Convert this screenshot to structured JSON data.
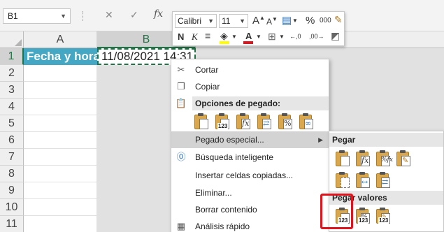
{
  "formula_bar": {
    "name_box": "B1",
    "cancel_icon": "✕",
    "enter_icon": "✓",
    "fx": "fx"
  },
  "columns": [
    "A",
    "B"
  ],
  "rows": [
    "1",
    "2",
    "3",
    "4",
    "5",
    "6",
    "7",
    "8",
    "9",
    "10",
    "11"
  ],
  "cells": {
    "A1": "Fecha y hora:",
    "B1": "11/08/2021 14:31"
  },
  "mini_toolbar": {
    "font_name": "Calibri",
    "font_size": "11",
    "grow_font": "A",
    "shrink_font": "A",
    "percent": "%",
    "thousands": "000",
    "bold": "N",
    "italic": "K",
    "increase_decimal": "←,0",
    "decrease_decimal": ",00→"
  },
  "context_menu": {
    "cut": "Cortar",
    "copy": "Copiar",
    "paste_options_header": "Opciones de pegado:",
    "paste_special": "Pegado especial...",
    "smart_lookup": "Búsqueda inteligente",
    "insert_copied": "Insertar celdas copiadas...",
    "delete": "Eliminar...",
    "clear_contents": "Borrar contenido",
    "quick_analysis": "Análisis rápido"
  },
  "paste_icon_labels": {
    "values": "123",
    "formulas": "fx",
    "formula_format": "%fx"
  },
  "submenu": {
    "paste_header": "Pegar",
    "paste_values_header": "Pegar valores"
  },
  "colors": {
    "header_fill": "#44a8c4",
    "selection_green": "#217346",
    "highlight_red": "#e0141c"
  }
}
